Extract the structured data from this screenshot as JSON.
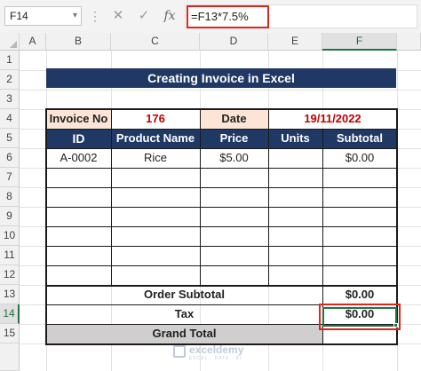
{
  "formula_bar": {
    "name_box": "F14",
    "name_box_arrow": "▾",
    "dots": "⋮",
    "cancel_icon": "✕",
    "enter_icon": "✓",
    "fx_label": "fx",
    "formula": "=F13*7.5%"
  },
  "columns": [
    "A",
    "B",
    "C",
    "D",
    "E",
    "F"
  ],
  "rows": [
    "1",
    "2",
    "3",
    "4",
    "5",
    "6",
    "7",
    "8",
    "9",
    "10",
    "11",
    "12",
    "13",
    "14",
    "15"
  ],
  "selected": {
    "column": "F",
    "row": "14",
    "cell": "F14"
  },
  "sheet": {
    "title": "Creating Invoice in Excel",
    "invoice_no_label": "Invoice No",
    "invoice_no_value": "176",
    "date_label": "Date",
    "date_value": "19/11/2022",
    "table_headers": {
      "id": "ID",
      "product": "Product Name",
      "price": "Price",
      "units": "Units",
      "subtotal": "Subtotal"
    },
    "row6": {
      "id": "A-0002",
      "product": "Rice",
      "price": "$5.00",
      "units": "",
      "subtotal": "$0.00"
    },
    "order_subtotal_label": "Order Subtotal",
    "order_subtotal_value": "$0.00",
    "tax_label": "Tax",
    "tax_value": "$0.00",
    "grand_total_label": "Grand Total",
    "grand_total_value": ""
  },
  "colors": {
    "header_navy": "#203864",
    "peach": "#fce4d6",
    "accent_red": "#c00000",
    "highlight_red": "#e0251b",
    "selection_green": "#217346",
    "grand_total_grey": "#d0cece"
  },
  "watermark": {
    "name": "exceldemy",
    "tagline": "EXCEL · DATA · BI"
  }
}
